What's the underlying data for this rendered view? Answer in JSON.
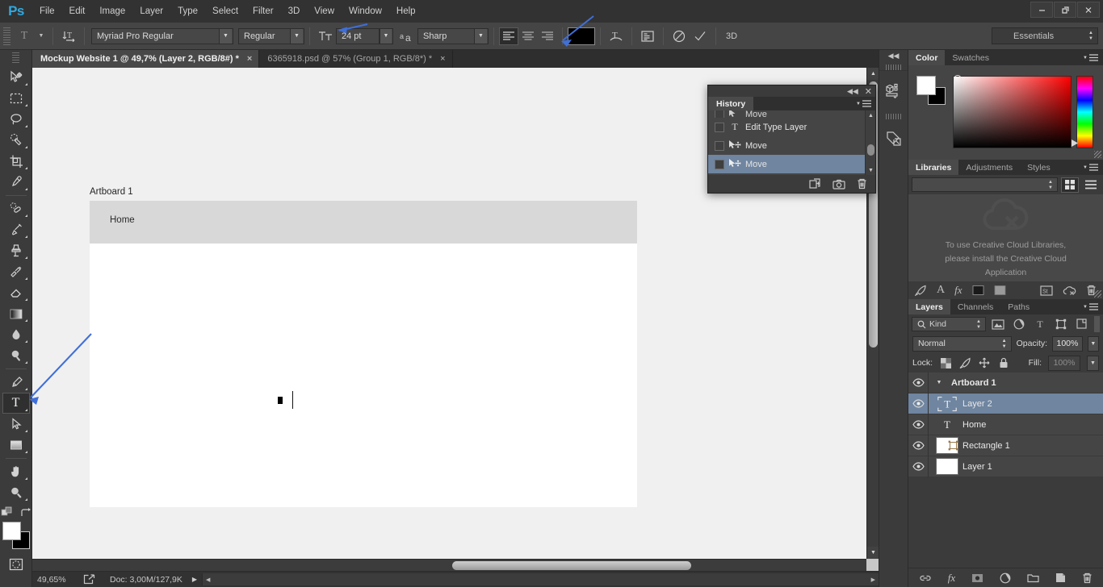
{
  "app": {
    "logo": "Ps",
    "menus": [
      "File",
      "Edit",
      "Image",
      "Layer",
      "Type",
      "Select",
      "Filter",
      "3D",
      "View",
      "Window",
      "Help"
    ],
    "window_buttons": [
      "minimize",
      "restore",
      "close"
    ],
    "workspace": "Essentials"
  },
  "options_bar": {
    "tool_icon": "type-tool-icon",
    "orientation_icon": "text-orientation-icon",
    "font_family": "Myriad Pro Regular",
    "font_style": "Regular",
    "font_size": "24 pt",
    "antialias_icon": "anti-alias-icon",
    "antialias": "Sharp",
    "align": [
      "align-left",
      "align-center",
      "align-right"
    ],
    "align_active": "align-left",
    "text_color": "#000000",
    "warp_icon": "warp-text-icon",
    "panels_icon": "character-panel-icon",
    "cancel_icon": "cancel-edits-icon",
    "commit_icon": "commit-edits-icon",
    "threed_label": "3D"
  },
  "toolbar": {
    "tools": [
      {
        "name": "move-tool",
        "glyph": "move"
      },
      {
        "name": "rectangular-marquee-tool",
        "glyph": "marquee"
      },
      {
        "name": "lasso-tool",
        "glyph": "lasso"
      },
      {
        "name": "quick-selection-tool",
        "glyph": "quickselect"
      },
      {
        "name": "crop-tool",
        "glyph": "crop"
      },
      {
        "name": "eyedropper-tool",
        "glyph": "eyedropper"
      },
      {
        "name": "spot-healing-brush-tool",
        "glyph": "heal"
      },
      {
        "name": "brush-tool",
        "glyph": "brush"
      },
      {
        "name": "clone-stamp-tool",
        "glyph": "stamp"
      },
      {
        "name": "history-brush-tool",
        "glyph": "historybrush"
      },
      {
        "name": "eraser-tool",
        "glyph": "eraser"
      },
      {
        "name": "gradient-tool",
        "glyph": "gradient"
      },
      {
        "name": "blur-tool",
        "glyph": "blur"
      },
      {
        "name": "dodge-tool",
        "glyph": "dodge"
      },
      {
        "name": "pen-tool",
        "glyph": "pen"
      },
      {
        "name": "horizontal-type-tool",
        "glyph": "type"
      },
      {
        "name": "path-selection-tool",
        "glyph": "pathselect"
      },
      {
        "name": "rectangle-tool",
        "glyph": "rectangle"
      },
      {
        "name": "hand-tool",
        "glyph": "hand"
      },
      {
        "name": "zoom-tool",
        "glyph": "zoom"
      }
    ],
    "active_tool": "horizontal-type-tool",
    "foreground_color": "#ffffff",
    "background_color": "#000000",
    "quickmask_label": "edit-in-quick-mask-mode"
  },
  "document_tabs": [
    {
      "label": "Mockup Website 1 @ 49,7% (Layer 2, RGB/8#) *",
      "active": true,
      "close": "×"
    },
    {
      "label": "6365918.psd @ 57% (Group 1, RGB/8*) *",
      "active": false,
      "close": "×"
    }
  ],
  "canvas": {
    "artboard_label": "Artboard 1",
    "nav_text": "Home",
    "caret_visible": true
  },
  "status_bar": {
    "zoom": "49,65%",
    "share_icon": "share-icon",
    "doc_info": "Doc: 3,00M/127,9K",
    "expand_arrow": "▶"
  },
  "history_panel": {
    "title": "History",
    "collapse_icon": "collapse-panel-icon",
    "close_icon": "close-panel-icon",
    "menu_icon": "panel-menu-icon",
    "items": [
      {
        "label": "Move",
        "icon": "move-icon",
        "selected": false,
        "partial": true
      },
      {
        "label": "Edit Type Layer",
        "icon": "type-icon",
        "selected": false,
        "partial": false
      },
      {
        "label": "Move",
        "icon": "move-icon",
        "selected": false,
        "partial": false
      },
      {
        "label": "Move",
        "icon": "move-icon",
        "selected": true,
        "partial": false
      }
    ],
    "footer_icons": [
      "create-document-from-state-icon",
      "create-new-snapshot-icon",
      "delete-state-icon"
    ]
  },
  "mini_dock": {
    "collapse_icon": "collapse-to-icons-icon",
    "items": [
      "3d-panel-icon",
      "properties-panel-icon"
    ]
  },
  "color_panel": {
    "tabs": [
      "Color",
      "Swatches"
    ],
    "active_tab": "Color",
    "foreground": "#ffffff",
    "background": "#000000",
    "menu_icon": "panel-menu-icon"
  },
  "libraries_panel": {
    "tabs": [
      "Libraries",
      "Adjustments",
      "Styles"
    ],
    "active_tab": "Libraries",
    "search_value": "",
    "view_grid_icon": "grid-view-icon",
    "view_list_icon": "list-view-icon",
    "cloud_icon": "cloud-off-icon",
    "message_lines": [
      "To use Creative Cloud Libraries,",
      "please install the Creative Cloud",
      "Application"
    ],
    "footer_icons": [
      "brush-preset-icon",
      "text-style-icon",
      "layer-style-icon",
      "foreground-color-icon",
      "background-color-icon",
      "st-icon",
      "cloud-off-small-icon",
      "delete-icon"
    ]
  },
  "layers_panel": {
    "tabs": [
      "Layers",
      "Channels",
      "Paths"
    ],
    "active_tab": "Layers",
    "menu_icon": "panel-menu-icon",
    "filter": {
      "label": "Kind",
      "search_icon": "search-icon",
      "type_icons": [
        "pixel-filter-icon",
        "adjustment-filter-icon",
        "type-filter-icon",
        "shape-filter-icon",
        "smart-object-filter-icon"
      ],
      "toggle_icon": "filter-toggle-icon"
    },
    "blend_mode": "Normal",
    "opacity_label": "Opacity:",
    "opacity_value": "100%",
    "lock_label": "Lock:",
    "lock_icons": [
      "lock-transparent-pixels-icon",
      "lock-image-pixels-icon",
      "lock-position-icon",
      "lock-all-icon"
    ],
    "fill_label": "Fill:",
    "fill_value": "100%",
    "layers": [
      {
        "name": "Artboard 1",
        "type": "artboard",
        "selected": false,
        "expanded": true,
        "indent": 0
      },
      {
        "name": "Layer 2",
        "type": "text-selected",
        "selected": true,
        "indent": 1
      },
      {
        "name": "Home",
        "type": "text",
        "selected": false,
        "indent": 1
      },
      {
        "name": "Rectangle 1",
        "type": "shape",
        "selected": false,
        "indent": 1
      },
      {
        "name": "Layer 1",
        "type": "raster",
        "selected": false,
        "indent": 1
      }
    ],
    "footer_icons": [
      "link-layers-icon",
      "add-layer-style-icon",
      "add-layer-mask-icon",
      "new-fill-adjustment-icon",
      "new-group-icon",
      "new-layer-icon",
      "delete-layer-icon"
    ]
  },
  "annotations": {
    "arrow_color": "#3f6fd8",
    "arrows": [
      "font-size-arrow",
      "text-color-arrow",
      "type-tool-arrow"
    ]
  }
}
